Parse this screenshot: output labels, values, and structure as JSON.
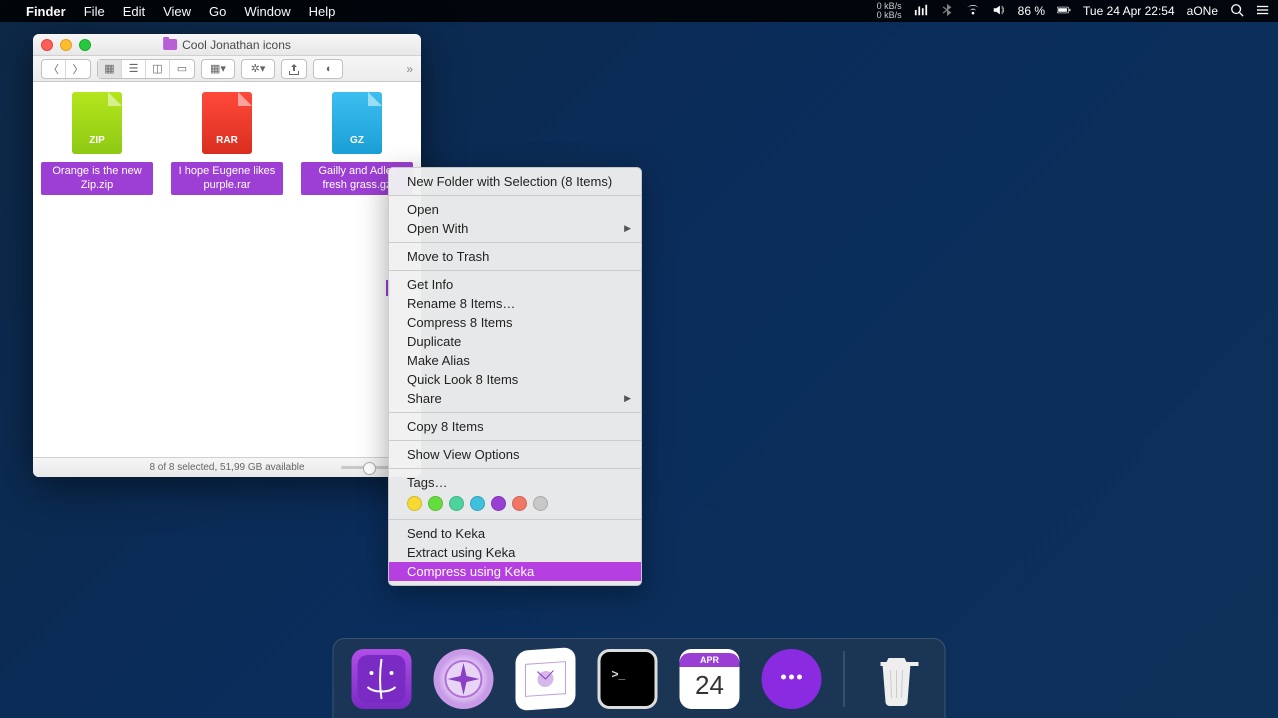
{
  "menubar": {
    "app": "Finder",
    "items": [
      "File",
      "Edit",
      "View",
      "Go",
      "Window",
      "Help"
    ],
    "net_up": "0 kB/s",
    "net_down": "0 kB/s",
    "battery_pct": "86 %",
    "datetime": "Tue 24 Apr  22:54",
    "user": "aONe"
  },
  "window": {
    "title": "Cool Jonathan icons",
    "status": "8 of 8 selected, 51,99 GB available"
  },
  "files": [
    {
      "ext": "ZIP",
      "cls": "zip",
      "label": "Orange is the new Zip.zip"
    },
    {
      "ext": "RAR",
      "cls": "rar",
      "label": "I hope Eugene likes purple.rar"
    },
    {
      "ext": "GZ",
      "cls": "gz",
      "label": "Gailly and Adler fresh grass.gz"
    }
  ],
  "context": {
    "groups": [
      [
        "New Folder with Selection (8 Items)"
      ],
      [
        "Open",
        "Open With"
      ],
      [
        "Move to Trash"
      ],
      [
        "Get Info",
        "Rename 8 Items…",
        "Compress 8 Items",
        "Duplicate",
        "Make Alias",
        "Quick Look 8 Items",
        "Share"
      ],
      [
        "Copy 8 Items"
      ],
      [
        "Show View Options"
      ],
      [
        "Tags…"
      ],
      [
        "Send to Keka",
        "Extract using Keka",
        "Compress using Keka"
      ]
    ],
    "submenu_items": [
      "Open With",
      "Share"
    ],
    "highlighted": "Compress using Keka",
    "tag_colors": [
      "#f7d932",
      "#66dd3f",
      "#4cd49c",
      "#3fc0dd",
      "#9a3fd4",
      "#f27666",
      "#c8c8c8"
    ]
  },
  "dock": {
    "cal_month": "APR",
    "cal_day": "24"
  }
}
